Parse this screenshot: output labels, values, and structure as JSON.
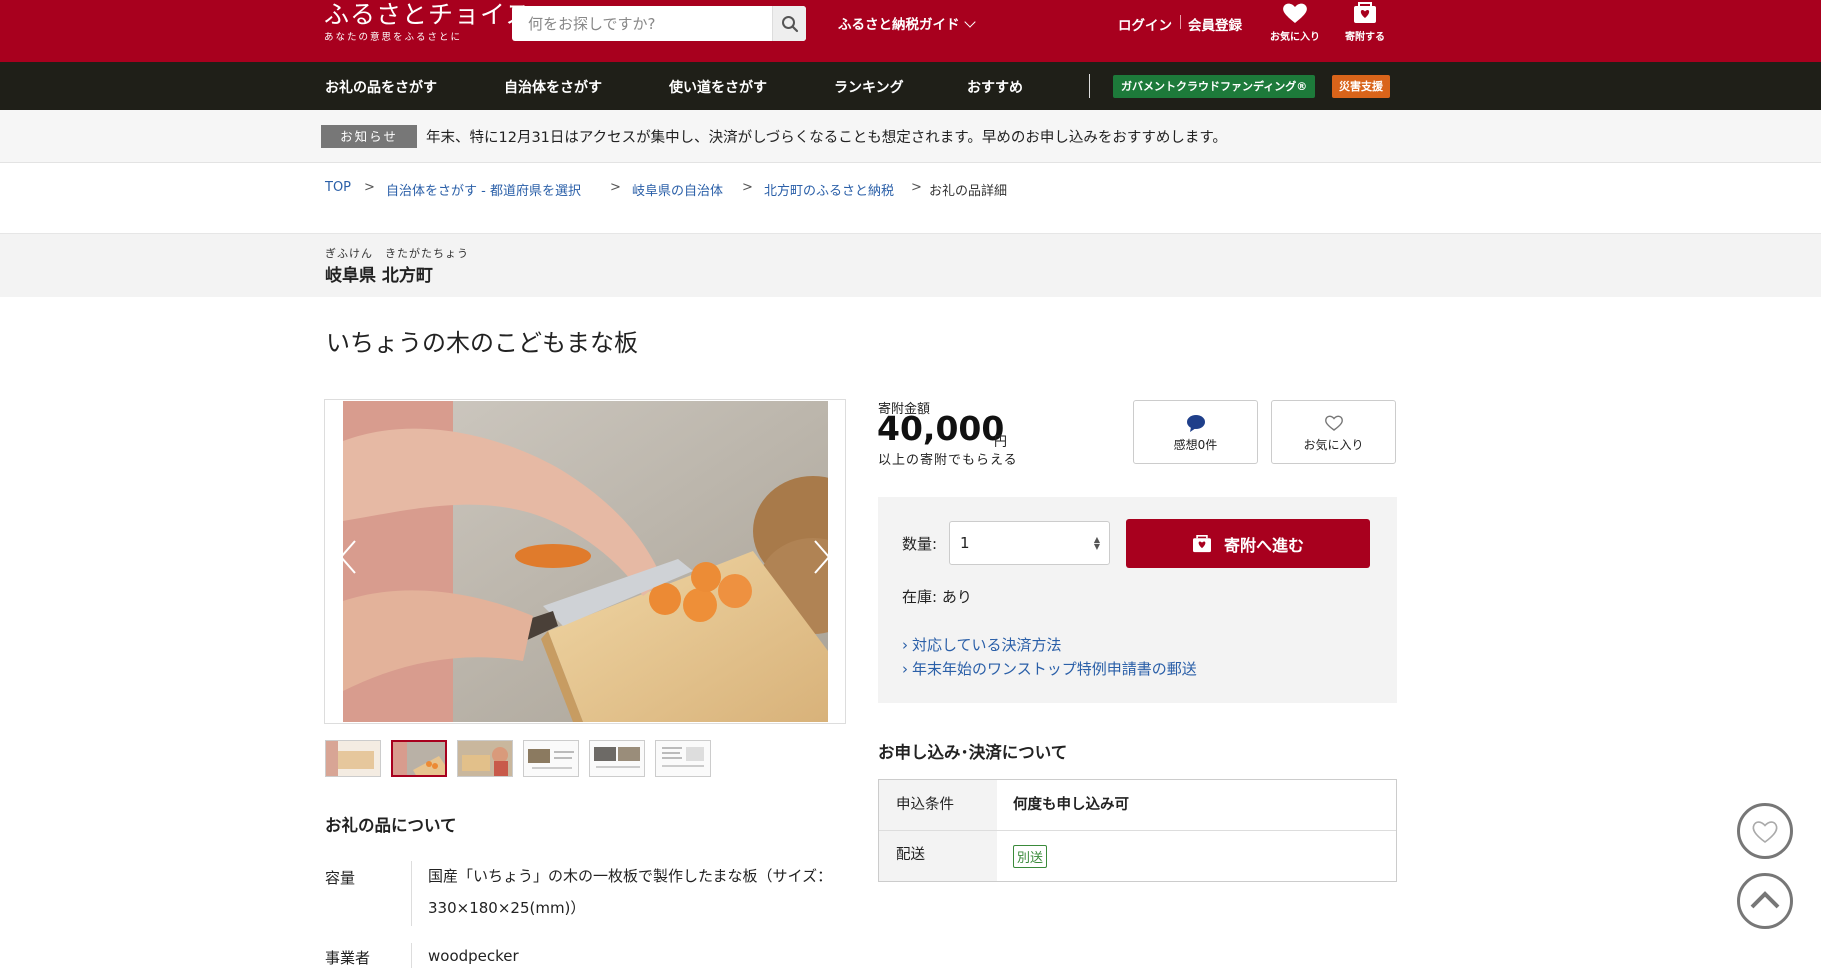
{
  "header": {
    "logo_main": "ふるさとチョイス",
    "logo_sub": "あなたの意思をふるさとに",
    "search_placeholder": "何をお探しですか?",
    "guide_label": "ふるさと納税ガイド",
    "login_label": "ログイン",
    "register_label": "会員登録",
    "favorites_label": "お気に入り",
    "donate_label": "寄附する"
  },
  "nav": {
    "items": [
      "お礼の品をさがす",
      "自治体をさがす",
      "使い道をさがす",
      "ランキング",
      "おすすめ"
    ],
    "gcf_label": "ガバメントクラウドファンディング®",
    "disaster_label": "災害支援"
  },
  "notice": {
    "tag": "お知らせ",
    "message": "年末、特に12月31日はアクセスが集中し、決済がしづらくなることも想定されます。早めのお申し込みをおすすめします。"
  },
  "breadcrumb": {
    "items": [
      "TOP",
      "自治体をさがす - 都道府県を選択",
      "岐阜県の自治体",
      "北方町のふるさと納税",
      "お礼の品詳細"
    ],
    "separator": ">"
  },
  "municipality": {
    "ruby": "ぎふけん　きたがたちょう",
    "name": "岐阜県 北方町"
  },
  "product": {
    "title": "いちょうの木のこどもまな板",
    "gallery_active_index": 1,
    "thumbnail_count": 6
  },
  "about": {
    "heading": "お礼の品について",
    "specs": [
      {
        "label": "容量",
        "value": "国産「いちょう」の木の一枚板で製作したまな板（サイズ：330×180×25(mm)）"
      },
      {
        "label": "事業者",
        "value": "woodpecker"
      }
    ]
  },
  "donation": {
    "amount_label": "寄附金額",
    "amount": "40,000",
    "currency": "円",
    "amount_note": "以上の寄附でもらえる",
    "reviews_label": "感想0件",
    "favorite_label": "お気に入り",
    "qty_label": "数量:",
    "qty_value": "1",
    "donate_button": "寄附へ進む",
    "stock_label": "在庫:",
    "stock_value": "あり",
    "links": [
      "対応している決済方法",
      "年末年始のワンストップ特例申請書の郵送"
    ]
  },
  "application": {
    "heading": "お申し込み･決済について",
    "rows": [
      {
        "label": "申込条件",
        "value": "何度も申し込み可"
      },
      {
        "label": "配送",
        "value": "別送"
      }
    ]
  },
  "colors": {
    "brand_red": "#a8001e",
    "nav_dark": "#1f1f18",
    "link_blue": "#2a5fa8",
    "gcf_green": "#1d7a3a",
    "disaster_orange": "#d9641a"
  }
}
